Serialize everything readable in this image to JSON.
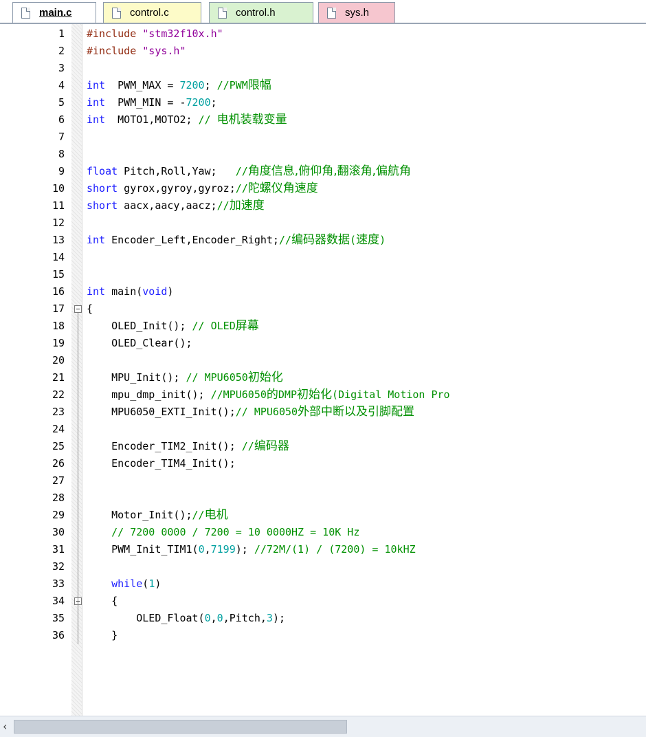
{
  "tabs": [
    {
      "label": "main.c",
      "active": true,
      "color": "#ffffff"
    },
    {
      "label": "control.c",
      "active": false,
      "color": "#fdfbc8"
    },
    {
      "label": "control.h",
      "active": false,
      "color": "#d9f2d0"
    },
    {
      "label": "sys.h",
      "active": false,
      "color": "#f6c6cf"
    }
  ],
  "editor": {
    "lines": [
      {
        "n": "1",
        "t": [
          [
            "pp",
            "#include "
          ],
          [
            "str",
            "\"stm32f10x.h\""
          ]
        ]
      },
      {
        "n": "2",
        "t": [
          [
            "pp",
            "#include "
          ],
          [
            "str",
            "\"sys.h\""
          ]
        ]
      },
      {
        "n": "3",
        "t": []
      },
      {
        "n": "4",
        "t": [
          [
            "kw",
            "int"
          ],
          [
            "",
            "  PWM_MAX = "
          ],
          [
            "num",
            "7200"
          ],
          [
            "",
            "; "
          ],
          [
            "cm",
            "//PWM"
          ],
          [
            "cm cjk",
            "限幅"
          ]
        ]
      },
      {
        "n": "5",
        "t": [
          [
            "kw",
            "int"
          ],
          [
            "",
            "  PWM_MIN = -"
          ],
          [
            "num",
            "7200"
          ],
          [
            ";",
            ""
          ]
        ]
      },
      {
        "n": "6",
        "t": [
          [
            "kw",
            "int"
          ],
          [
            "",
            "  MOTO1,MOTO2; "
          ],
          [
            "cm",
            "// "
          ],
          [
            "cm cjk",
            "电机装载变量"
          ]
        ]
      },
      {
        "n": "7",
        "t": []
      },
      {
        "n": "8",
        "t": []
      },
      {
        "n": "9",
        "t": [
          [
            "kw",
            "float"
          ],
          [
            "",
            " Pitch,Roll,Yaw;   "
          ],
          [
            "cm",
            "//"
          ],
          [
            "cm cjk",
            "角度信息,俯仰角,翻滚角,偏航角"
          ]
        ]
      },
      {
        "n": "10",
        "t": [
          [
            "kw",
            "short"
          ],
          [
            "",
            " gyrox,gyroy,gyroz;"
          ],
          [
            "cm",
            "//"
          ],
          [
            "cm cjk",
            "陀螺仪角速度"
          ]
        ]
      },
      {
        "n": "11",
        "t": [
          [
            "kw",
            "short"
          ],
          [
            "",
            " aacx,aacy,aacz;"
          ],
          [
            "cm",
            "//"
          ],
          [
            "cm cjk",
            "加速度"
          ]
        ]
      },
      {
        "n": "12",
        "t": []
      },
      {
        "n": "13",
        "t": [
          [
            "kw",
            "int"
          ],
          [
            "",
            " Encoder_Left,Encoder_Right;"
          ],
          [
            "cm",
            "//"
          ],
          [
            "cm cjk",
            "编码器数据"
          ],
          [
            "cm",
            "("
          ],
          [
            "cm cjk",
            "速度"
          ],
          [
            "cm",
            ")"
          ]
        ]
      },
      {
        "n": "14",
        "t": []
      },
      {
        "n": "15",
        "t": []
      },
      {
        "n": "16",
        "t": [
          [
            "kw",
            "int"
          ],
          [
            "",
            " main("
          ],
          [
            "kw",
            "void"
          ],
          [
            "",
            ")"
          ]
        ]
      },
      {
        "n": "17",
        "t": [
          [
            "",
            "{"
          ]
        ],
        "fold": true
      },
      {
        "n": "18",
        "t": [
          [
            "",
            "    OLED_Init(); "
          ],
          [
            "cm",
            "// OLED"
          ],
          [
            "cm cjk",
            "屏幕"
          ]
        ]
      },
      {
        "n": "19",
        "t": [
          [
            "",
            "    OLED_Clear();"
          ]
        ]
      },
      {
        "n": "20",
        "t": []
      },
      {
        "n": "21",
        "t": [
          [
            "",
            "    MPU_Init(); "
          ],
          [
            "cm",
            "// MPU6050"
          ],
          [
            "cm cjk",
            "初始化"
          ]
        ]
      },
      {
        "n": "22",
        "t": [
          [
            "",
            "    mpu_dmp_init(); "
          ],
          [
            "cm",
            "//MPU6050"
          ],
          [
            "cm cjk",
            "的"
          ],
          [
            "cm",
            "DMP"
          ],
          [
            "cm cjk",
            "初始化"
          ],
          [
            "cm",
            "(Digital Motion Pro"
          ]
        ]
      },
      {
        "n": "23",
        "t": [
          [
            "",
            "    MPU6050_EXTI_Init();"
          ],
          [
            "cm",
            "// MPU6050"
          ],
          [
            "cm cjk",
            "外部中断以及引脚配置"
          ]
        ]
      },
      {
        "n": "24",
        "t": []
      },
      {
        "n": "25",
        "t": [
          [
            "",
            "    Encoder_TIM2_Init(); "
          ],
          [
            "cm",
            "//"
          ],
          [
            "cm cjk",
            "编码器"
          ]
        ]
      },
      {
        "n": "26",
        "t": [
          [
            "",
            "    Encoder_TIM4_Init();"
          ]
        ]
      },
      {
        "n": "27",
        "t": []
      },
      {
        "n": "28",
        "t": []
      },
      {
        "n": "29",
        "t": [
          [
            "",
            "    Motor_Init();"
          ],
          [
            "cm",
            "//"
          ],
          [
            "cm cjk",
            "电机"
          ]
        ]
      },
      {
        "n": "30",
        "t": [
          [
            "cm",
            "    // 7200 0000 / 7200 = 10 0000HZ = 10K Hz"
          ]
        ]
      },
      {
        "n": "31",
        "t": [
          [
            "",
            "    PWM_Init_TIM1("
          ],
          [
            "num",
            "0"
          ],
          [
            "",
            ","
          ],
          [
            "num",
            "7199"
          ],
          [
            "",
            "); "
          ],
          [
            "cm",
            "//72M/(1) / (7200) = 10kHZ"
          ]
        ]
      },
      {
        "n": "32",
        "t": []
      },
      {
        "n": "33",
        "t": [
          [
            "kw",
            "    while"
          ],
          [
            "",
            "("
          ],
          [
            "num",
            "1"
          ],
          [
            "",
            ")"
          ]
        ]
      },
      {
        "n": "34",
        "t": [
          [
            "",
            "    {"
          ]
        ],
        "fold": true
      },
      {
        "n": "35",
        "t": [
          [
            "",
            "        OLED_Float("
          ],
          [
            "num",
            "0"
          ],
          [
            "",
            ","
          ],
          [
            "num",
            "0"
          ],
          [
            "",
            ",Pitch,"
          ],
          [
            "num",
            "3"
          ],
          [
            "",
            ");"
          ]
        ]
      },
      {
        "n": "36",
        "t": [
          [
            "",
            "    }"
          ]
        ]
      }
    ]
  },
  "scrollbar": {
    "left_arrow": "‹"
  }
}
